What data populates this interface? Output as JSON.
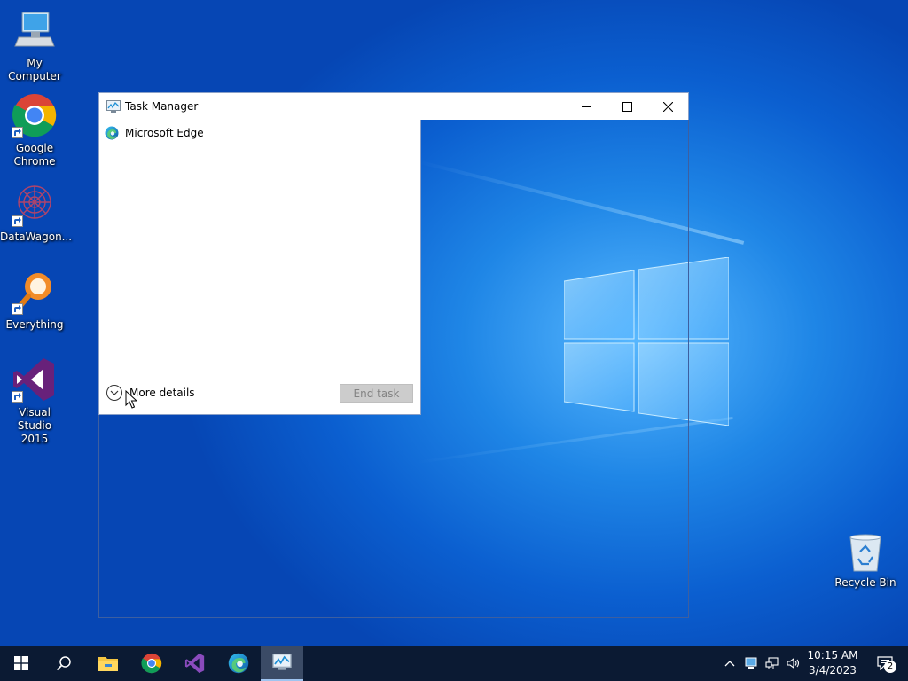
{
  "desktop": {
    "icons": [
      {
        "label": "My Computer"
      },
      {
        "label": "Google Chrome"
      },
      {
        "label": "DataWagon..."
      },
      {
        "label": "Everything"
      },
      {
        "label": "Visual Studio 2015"
      }
    ],
    "recycle_bin": {
      "label": "Recycle Bin"
    }
  },
  "task_manager": {
    "title": "Task Manager",
    "processes": [
      {
        "name": "Microsoft Edge"
      }
    ],
    "more_details_label": "More details",
    "end_task_label": "End task",
    "end_task_enabled": false
  },
  "taskbar": {
    "pinned": [
      "start",
      "search",
      "file-explorer",
      "google-chrome",
      "visual-studio",
      "microsoft-edge",
      "task-manager"
    ],
    "active": "task-manager",
    "clock": {
      "time": "10:15 AM",
      "date": "3/4/2023"
    },
    "notification_count": "2"
  },
  "colors": {
    "taskbar": "#0b1a33",
    "wallpaper": "#0b5fd0",
    "end_task_disabled_bg": "#cccccc"
  }
}
